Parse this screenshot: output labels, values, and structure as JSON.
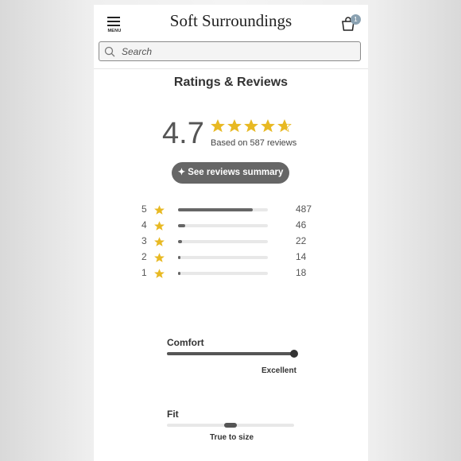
{
  "header": {
    "menu_label": "MENU",
    "logo": "Soft Surroundings",
    "cart_count": "1"
  },
  "search": {
    "placeholder": "Search"
  },
  "reviews": {
    "title": "Ratings & Reviews",
    "average": "4.7",
    "average_value": 4.7,
    "based_on": "Based on 587 reviews",
    "summary_button": "See reviews summary",
    "star_color": "#e8b923",
    "distribution": [
      {
        "stars": "5",
        "count": "487",
        "fraction": 0.83
      },
      {
        "stars": "4",
        "count": "46",
        "fraction": 0.08
      },
      {
        "stars": "3",
        "count": "22",
        "fraction": 0.04
      },
      {
        "stars": "2",
        "count": "14",
        "fraction": 0.025
      },
      {
        "stars": "1",
        "count": "18",
        "fraction": 0.03
      }
    ]
  },
  "attributes": {
    "comfort": {
      "label": "Comfort",
      "value": "Excellent",
      "level": 1.0
    },
    "fit": {
      "label": "Fit",
      "value": "True to size",
      "level": 0.5
    }
  }
}
